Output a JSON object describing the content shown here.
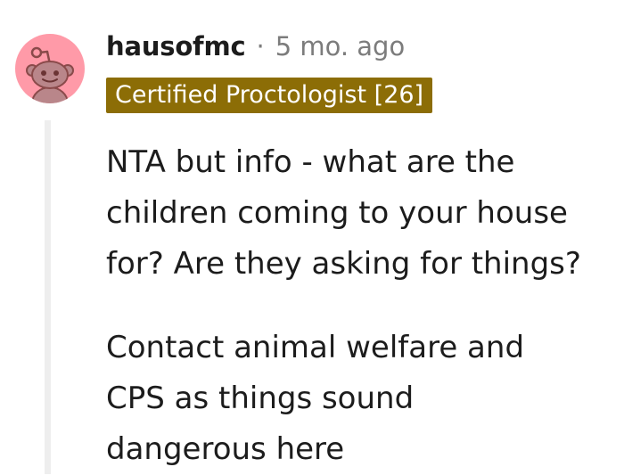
{
  "comment": {
    "avatar_icon": "reddit-snoo-avatar-icon",
    "avatar_color": "#ff9aa8",
    "username": "hausofmc",
    "separator": "·",
    "timestamp": "5 mo. ago",
    "flair": {
      "text": "Certified Proctologist [26]",
      "background": "#8c6d06"
    },
    "paragraphs": [
      "NTA but info - what are the\nchildren coming to your house\nfor? Are they asking for things?",
      "Contact animal welfare and\nCPS as things sound\ndangerous here"
    ]
  }
}
